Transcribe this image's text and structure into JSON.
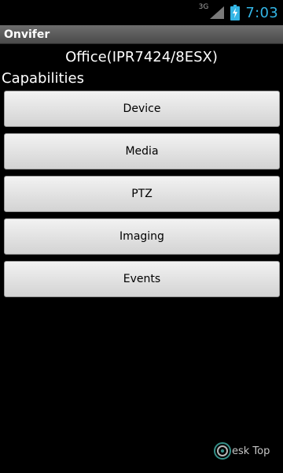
{
  "status_bar": {
    "network_type": "3G",
    "time": "7:03",
    "accent_color": "#33b5e5",
    "icons": [
      "signal-icon",
      "battery-charging-icon"
    ]
  },
  "app": {
    "title": "Onvifer"
  },
  "device": {
    "name": "Office(IPR7424/8ESX)"
  },
  "capabilities": {
    "heading": "Capabilities",
    "buttons": [
      {
        "label": "Device"
      },
      {
        "label": "Media"
      },
      {
        "label": "PTZ"
      },
      {
        "label": "Imaging"
      },
      {
        "label": "Events"
      }
    ]
  },
  "watermark": {
    "text": "esk Top",
    "logo_letter": "D"
  }
}
